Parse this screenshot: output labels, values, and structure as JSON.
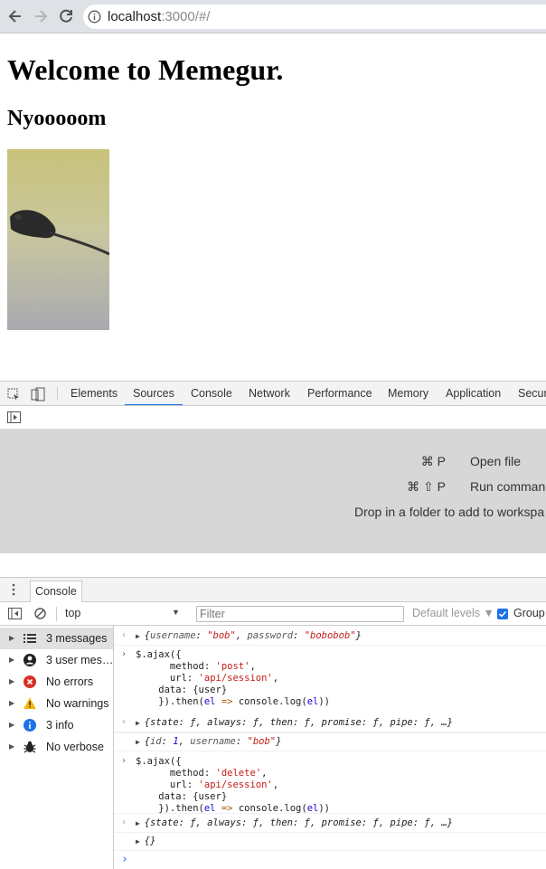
{
  "browser": {
    "url_host": "localhost",
    "url_path": ":3000/#/"
  },
  "page": {
    "title": "Welcome to Memegur.",
    "subtitle": "Nyooooom"
  },
  "devtools": {
    "tabs": [
      "Elements",
      "Sources",
      "Console",
      "Network",
      "Performance",
      "Memory",
      "Application",
      "Secur"
    ],
    "active_tab": "Sources",
    "sources_shortcuts": [
      {
        "keys": "⌘ P",
        "label": "Open file"
      },
      {
        "keys": "⌘ ⇧ P",
        "label": "Run comman"
      }
    ],
    "drop_hint": "Drop in a folder to add to workspa",
    "drawer_tab": "Console",
    "context": "top",
    "filter_placeholder": "Filter",
    "levels": "Default levels ▼",
    "group_label": "Group",
    "sidebar": [
      {
        "label": "3 messages",
        "icon": "list-icon"
      },
      {
        "label": "3 user mes…",
        "icon": "user-icon"
      },
      {
        "label": "No errors",
        "icon": "error-icon"
      },
      {
        "label": "No warnings",
        "icon": "warning-icon"
      },
      {
        "label": "3 info",
        "icon": "info-icon"
      },
      {
        "label": "No verbose",
        "icon": "bug-icon"
      }
    ],
    "log": {
      "m1": {
        "k1": "username",
        "v1": "\"bob\"",
        "k2": "password",
        "v2": "\"bobobob\""
      },
      "m2": {
        "method": "'post'",
        "url": "'api/session'"
      },
      "m3": "{state: ƒ, always: ƒ, then: ƒ, promise: ƒ, pipe: ƒ, …}",
      "m4": {
        "k1": "id",
        "v1": "1",
        "k2": "username",
        "v2": "\"bob\""
      },
      "m5": {
        "method": "'delete'",
        "url": "'api/session'"
      },
      "m6": "{state: ƒ, always: ƒ, then: ƒ, promise: ƒ, pipe: ƒ, …}",
      "m7": "{}"
    }
  }
}
